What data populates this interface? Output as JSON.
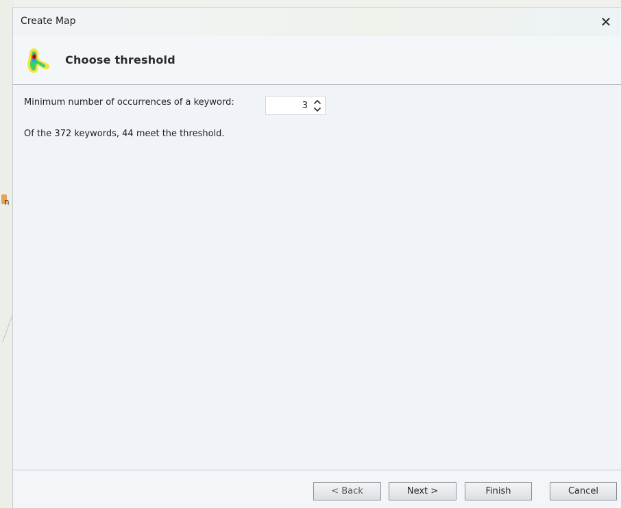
{
  "window": {
    "title": "Create Map",
    "close_glyph": "✕"
  },
  "header": {
    "heading": "Choose threshold",
    "icon": "heatmap-logo-icon"
  },
  "threshold": {
    "label": "Minimum number of occurrences of a keyword:",
    "value": "3"
  },
  "info": {
    "prefix": "Of the ",
    "total": "372",
    "middle": " keywords, ",
    "meet": "44",
    "suffix": " meet the threshold."
  },
  "buttons": {
    "back": "< Back",
    "next": "Next >",
    "finish": "Finish",
    "cancel": "Cancel"
  },
  "background": {
    "partial_text": "n"
  },
  "colors": {
    "accent": "#f2f5f8",
    "button_border": "#8a8e94"
  }
}
